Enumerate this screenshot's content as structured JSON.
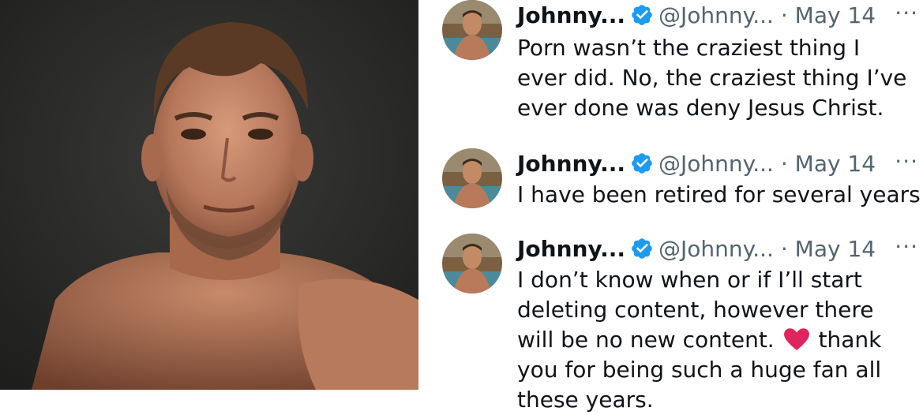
{
  "photo": {
    "description_icon": "selfie-photo"
  },
  "tweets": [
    {
      "name": "Johnny...",
      "handle": "@Johnny...",
      "separator": "·",
      "date": "May 14",
      "more": "···",
      "text": "Porn wasn’t the craziest thing I ever did. No, the craziest thing I’ve ever done was deny Jesus Christ."
    },
    {
      "name": "Johnny...",
      "handle": "@Johnny...",
      "separator": "·",
      "date": "May 14",
      "more": "···",
      "text": "I have been retired for several years"
    },
    {
      "name": "Johnny...",
      "handle": "@Johnny...",
      "separator": "·",
      "date": "May 14",
      "more": "···",
      "text_before": "I don’t know when or if I’ll start deleting content, however there will be no new content.",
      "text_after": "thank you for being such a huge fan all these years."
    }
  ],
  "colors": {
    "verified_badge": "#1d9bf0",
    "heart": "#e0245e",
    "secondary_text": "#536471",
    "primary_text": "#0f1419"
  },
  "icons": {
    "verified": "verified-badge-icon",
    "heart": "red-heart-emoji",
    "more": "more-options-icon"
  }
}
